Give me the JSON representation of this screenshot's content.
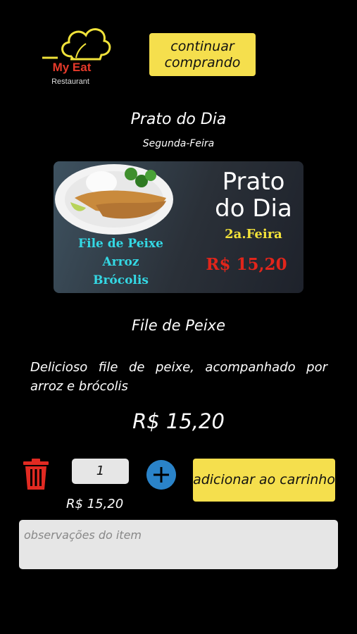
{
  "header": {
    "logo_text": "My Eat",
    "logo_subtext": "Restaurant",
    "continue_button_label": "continuar comprando"
  },
  "dish": {
    "title": "Prato do Dia",
    "day": "Segunda-Feira",
    "name": "File de Peixe",
    "description": "Delicioso file de peixe, acompanhado por arroz e brócolis",
    "price": "R$ 15,20"
  },
  "banner": {
    "line1": "File de Peixe",
    "line2": "Arroz",
    "line3": "Brócolis",
    "heading1": "Prato",
    "heading2": "do Dia",
    "day_label": "2a.Feira",
    "price": "R$ 15,20"
  },
  "order": {
    "quantity": "1",
    "add_button_label": "adicionar ao carrinho",
    "line_total": "R$ 15,20",
    "notes_placeholder": "observações do item"
  },
  "colors": {
    "accent_yellow": "#f5df4d",
    "trash_red": "#e12a22",
    "plus_blue": "#2a83c9",
    "background": "#000000"
  }
}
